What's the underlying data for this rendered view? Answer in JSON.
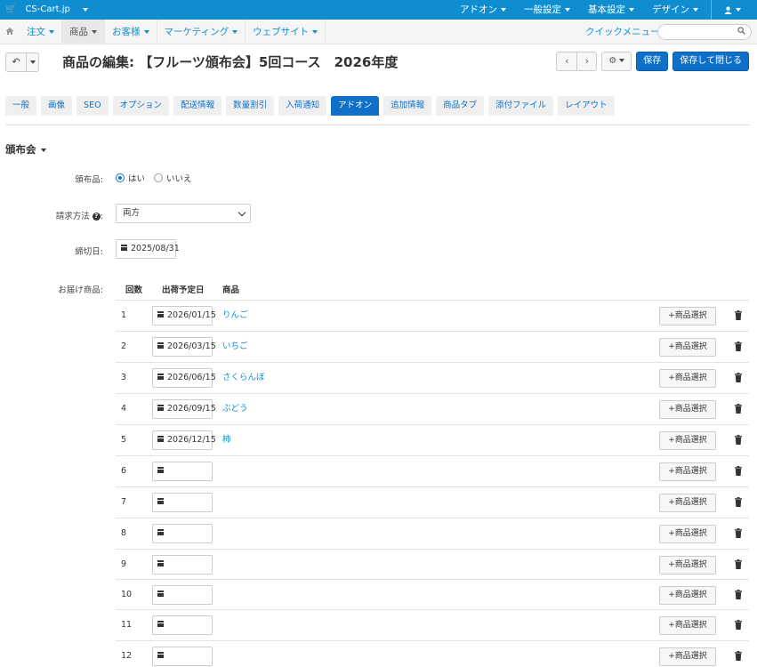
{
  "topbar": {
    "brand": "CS-Cart.jp",
    "menus": [
      "アドオン",
      "一般設定",
      "基本設定",
      "デザイン"
    ],
    "user_icon": "user-icon"
  },
  "navbar": {
    "items": [
      "注文",
      "商品",
      "お客様",
      "マーケティング",
      "ウェブサイト"
    ],
    "active": "商品",
    "quick_menu": "クイックメニュー",
    "search_placeholder": ""
  },
  "header": {
    "title": "商品の編集: 【フルーツ頒布会】5回コース　2026年度",
    "save": "保存",
    "save_close": "保存して閉じる"
  },
  "tabs": [
    {
      "label": "一般",
      "active": false
    },
    {
      "label": "画像",
      "active": false
    },
    {
      "label": "SEO",
      "active": false
    },
    {
      "label": "オプション",
      "active": false
    },
    {
      "label": "配送情報",
      "active": false
    },
    {
      "label": "数量割引",
      "active": false
    },
    {
      "label": "入荷通知",
      "active": false
    },
    {
      "label": "アドオン",
      "active": true
    },
    {
      "label": "追加情報",
      "active": false
    },
    {
      "label": "商品タブ",
      "active": false
    },
    {
      "label": "添付ファイル",
      "active": false
    },
    {
      "label": "レイアウト",
      "active": false
    }
  ],
  "section": {
    "title": "頒布会",
    "subscription_label": "頒布品:",
    "radio_yes": "はい",
    "radio_no": "いいえ",
    "billing_label": "請求方法",
    "billing_value": "両方",
    "deadline_label": "締切日:",
    "deadline_value": "2025/08/31",
    "delivery_label": "お届け商品:"
  },
  "table": {
    "col_count": "回数",
    "col_date": "出荷予定日",
    "col_product": "商品",
    "select_button": "商品選択",
    "rows": [
      {
        "num": "1",
        "date": "2026/01/15",
        "product": "りんご"
      },
      {
        "num": "2",
        "date": "2026/03/15",
        "product": "いちご"
      },
      {
        "num": "3",
        "date": "2026/06/15",
        "product": "さくらんぼ"
      },
      {
        "num": "4",
        "date": "2026/09/15",
        "product": "ぶどう"
      },
      {
        "num": "5",
        "date": "2026/12/15",
        "product": "柿"
      },
      {
        "num": "6",
        "date": "",
        "product": ""
      },
      {
        "num": "7",
        "date": "",
        "product": ""
      },
      {
        "num": "8",
        "date": "",
        "product": ""
      },
      {
        "num": "9",
        "date": "",
        "product": ""
      },
      {
        "num": "10",
        "date": "",
        "product": ""
      },
      {
        "num": "11",
        "date": "",
        "product": ""
      },
      {
        "num": "12",
        "date": "",
        "product": ""
      }
    ]
  },
  "colors": {
    "topbar": "#0e8ed1",
    "primary": "#0e70c9",
    "link": "#0e8ed1"
  }
}
